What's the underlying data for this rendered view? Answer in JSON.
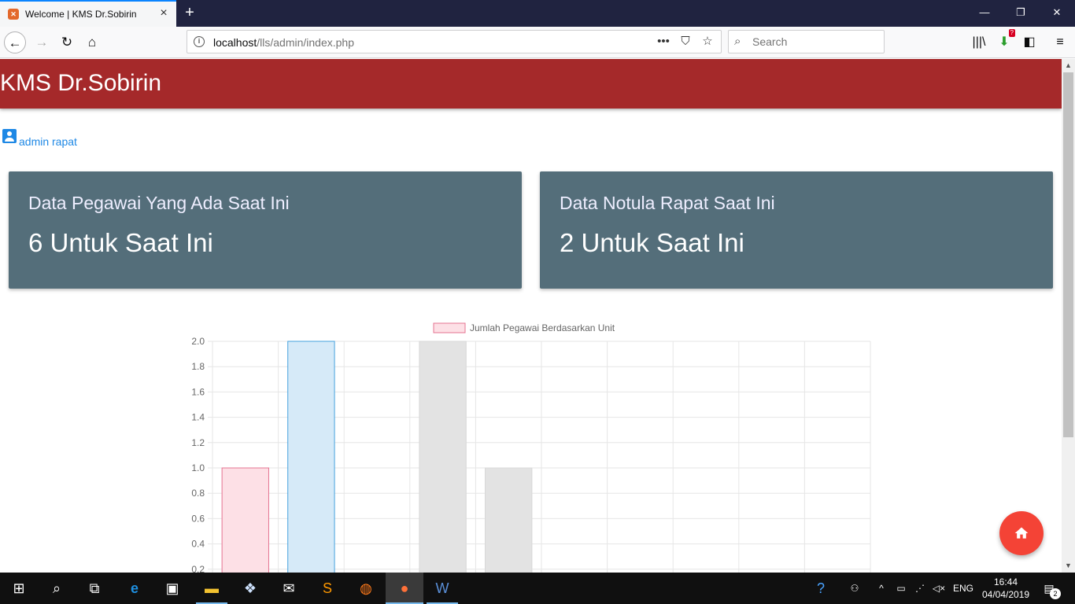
{
  "browser": {
    "tab_title": "Welcome | KMS Dr.Sobirin",
    "url_host": "localhost",
    "url_path": "/lls/admin/index.php",
    "search_placeholder": "Search",
    "download_badge": "?"
  },
  "app": {
    "title": "KMS Dr.Sobirin",
    "user_name": "admin rapat"
  },
  "cards": [
    {
      "label": "Data Pegawai Yang Ada Saat Ini",
      "value": "6 Untuk Saat Ini"
    },
    {
      "label": "Data Notula Rapat Saat Ini",
      "value": "2 Untuk Saat Ini"
    }
  ],
  "chart_data": {
    "type": "bar",
    "legend": "Jumlah Pegawai Berdasarkan Unit",
    "legend_position": "top",
    "grid": true,
    "ylim": [
      0,
      2.0
    ],
    "y_ticks": [
      "2.0",
      "1.8",
      "1.6",
      "1.4",
      "1.2",
      "1.0",
      "0.8",
      "0.6",
      "0.4",
      "0.2"
    ],
    "values": [
      1,
      2,
      0,
      2,
      1,
      0,
      0,
      0,
      0,
      0
    ],
    "bar_fills": [
      "#fde0e6",
      "#d6eaf8",
      "#e3e3e3",
      "#e3e3e3",
      "#e3e3e3",
      "#e3e3e3",
      "#e3e3e3",
      "#e3e3e3",
      "#e3e3e3",
      "#e3e3e3"
    ],
    "bar_strokes": [
      "#e57391",
      "#45a1de",
      "#d8d8d8",
      "#d8d8d8",
      "#d8d8d8",
      "#d8d8d8",
      "#d8d8d8",
      "#d8d8d8",
      "#d8d8d8",
      "#d8d8d8"
    ]
  },
  "taskbar": {
    "language": "ENG",
    "time": "16:44",
    "date": "04/04/2019",
    "notification_count": "2"
  },
  "colors": {
    "header": "#a5292a",
    "card": "#546e7a",
    "fab": "#f44336",
    "link": "#1e88e5"
  }
}
